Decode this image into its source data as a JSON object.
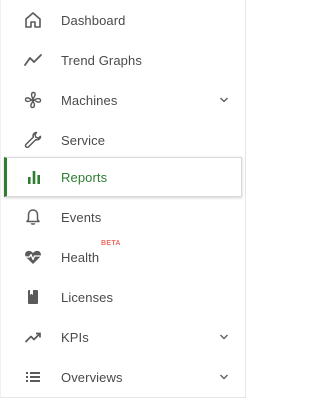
{
  "nav": {
    "items": [
      {
        "label": "Dashboard",
        "icon": "home-icon"
      },
      {
        "label": "Trend Graphs",
        "icon": "trend-line-icon"
      },
      {
        "label": "Machines",
        "icon": "fan-icon",
        "expandable": true
      },
      {
        "label": "Service",
        "icon": "wrench-icon"
      },
      {
        "label": "Reports",
        "icon": "bar-chart-icon",
        "active": true
      },
      {
        "label": "Events",
        "icon": "bell-icon"
      },
      {
        "label": "Health",
        "icon": "heartbeat-icon",
        "badge": "BETA"
      },
      {
        "label": "Licenses",
        "icon": "book-icon"
      },
      {
        "label": "KPIs",
        "icon": "trending-up-icon",
        "expandable": true
      },
      {
        "label": "Overviews",
        "icon": "list-icon",
        "expandable": true
      }
    ]
  },
  "colors": {
    "active": "#2e7d32",
    "text": "#4a4a4a",
    "icon": "#5a5a5a",
    "badge": "#ef6c60"
  }
}
